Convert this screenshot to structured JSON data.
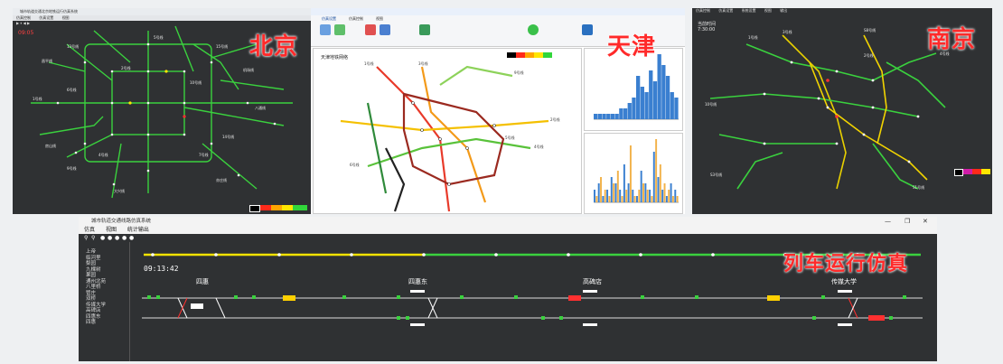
{
  "beijing": {
    "window_title": "城市轨道交通北京地铁运行仿真系统",
    "menu": [
      "仿真控制",
      "仿真设置",
      "视图"
    ],
    "time": "09:05",
    "label": "北京",
    "line_labels": [
      "13号线",
      "15号线",
      "昌平线",
      "5号线",
      "八通线",
      "6号线",
      "10号线",
      "房山线",
      "大兴线",
      "亦庄线",
      "4号线",
      "1号线",
      "2号线",
      "9号线",
      "14号线",
      "7号线",
      "机场线"
    ],
    "legend_colors": [
      "#000000",
      "#ff2a1a",
      "#ffa500",
      "#ffe600",
      "#31d63a"
    ]
  },
  "tianjin": {
    "label": "天津",
    "ribbon_items": [
      "仿真设置",
      "仿真控制",
      "视图"
    ],
    "map_title": "天津地铁网络",
    "line_labels": [
      "1号线",
      "2号线",
      "3号线",
      "4号线",
      "5号线",
      "6号线",
      "9号线"
    ],
    "legend_colors": [
      "#000000",
      "#ff2a1a",
      "#ffa500",
      "#ffe600",
      "#31d63a"
    ],
    "chart1": {
      "bars": [
        1,
        1,
        1,
        1,
        1,
        1,
        2,
        2,
        3,
        4,
        8,
        6,
        5,
        9,
        7,
        12,
        10,
        8,
        5,
        4
      ]
    },
    "chart2": {
      "bars_blue": [
        2,
        3,
        1,
        2,
        4,
        3,
        2,
        6,
        3,
        2,
        1,
        5,
        3,
        2,
        8,
        4,
        2,
        1,
        3,
        2
      ],
      "bars_orange": [
        1,
        4,
        2,
        1,
        3,
        5,
        1,
        2,
        9,
        1,
        2,
        3,
        2,
        1,
        10,
        6,
        3,
        2,
        1,
        1
      ]
    }
  },
  "nanjing": {
    "label": "南京",
    "menu": [
      "仿真控制",
      "仿真设置",
      "系统设置",
      "视图",
      "输出"
    ],
    "time_label": "当前时间",
    "time": "7:30:00",
    "line_labels": [
      "1号线",
      "2号线",
      "3号线",
      "4号线",
      "10号线",
      "S1号线",
      "S3号线",
      "S8号线"
    ],
    "legend_colors": [
      "#000000",
      "#d11ca8",
      "#ff2a1a",
      "#ffe600"
    ]
  },
  "main": {
    "window_title": "城市轨道交通线路仿真系统",
    "window_controls": [
      "—",
      "❐",
      "✕"
    ],
    "menu": [
      "仿真",
      "视图",
      "统计输出"
    ],
    "overlay_label": "列车运行仿真",
    "time": "09:13:42",
    "stations": [
      "四惠",
      "四惠东",
      "高碑店",
      "传媒大学"
    ],
    "sidebar_items": [
      "上帝",
      "临河里",
      "梨园",
      "九棵树",
      "果园",
      "通州北苑",
      "八里桥",
      "管庄",
      "双桥",
      "传媒大学",
      "高碑店",
      "四惠东",
      "四惠"
    ]
  }
}
